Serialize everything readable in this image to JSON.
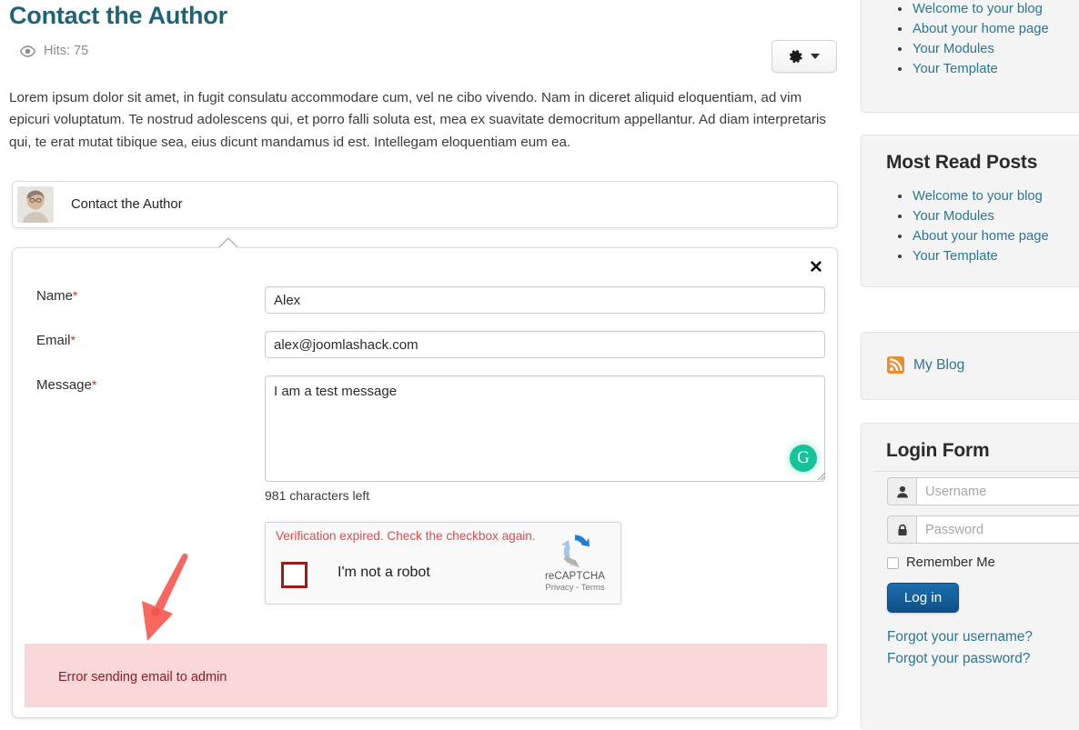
{
  "article": {
    "title": "Contact the Author",
    "hits_label": "Hits: 75",
    "body": "Lorem ipsum dolor sit amet, in fugit consulatu accommodare cum, vel ne cibo vivendo. Nam in diceret aliquid eloquentiam, ad vim epicuri voluptatum. Te nostrud adolescens qui, et porro falli soluta est, mea ex suavitate democritum appellantur. Ad diam interpretaris qui, te erat mutat tibique sea, eius dicunt mandamus id est. Intellegam eloquentiam eum ea.",
    "author_link_label": "Contact the Author"
  },
  "toolbar": {
    "gear_icon": "gear-icon",
    "caret_icon": "chevron-down-icon"
  },
  "contact_form": {
    "close_label": "✕",
    "fields": {
      "name": {
        "label": "Name",
        "required_marker": "*",
        "value": "Alex",
        "placeholder": ""
      },
      "email": {
        "label": "Email",
        "required_marker": "*",
        "value": "alex@joomlashack.com",
        "placeholder": ""
      },
      "message": {
        "label": "Message",
        "required_marker": "*",
        "value": "I am a test message",
        "placeholder": "",
        "characters_left": "981 characters left"
      }
    },
    "grammarly_badge": "G",
    "recaptcha": {
      "error_text": "Verification expired. Check the checkbox again.",
      "checkbox_label": "I'm not a robot",
      "brand_name": "reCAPTCHA",
      "terms_text": "Privacy - Terms",
      "checkbox_checked": false,
      "error_color": "#e04a4a",
      "checkbox_border_color": "#9c1a1a"
    },
    "alert": {
      "message": "Error sending email to admin",
      "background": "#f9d6d8",
      "text_color": "#8c1c28"
    }
  },
  "annotation": {
    "arrow_color": "#f7675f",
    "points_to": "Error sending email to admin"
  },
  "sidebar": {
    "top_module": {
      "items": [
        {
          "label": "Welcome to your blog"
        },
        {
          "label": "About your home page"
        },
        {
          "label": "Your Modules"
        },
        {
          "label": "Your Template"
        }
      ]
    },
    "most_read": {
      "title": "Most Read Posts",
      "items": [
        {
          "label": "Welcome to your blog"
        },
        {
          "label": "Your Modules"
        },
        {
          "label": "About your home page"
        },
        {
          "label": "Your Template"
        }
      ]
    },
    "syndicate": {
      "label": "My Blog",
      "icon": "rss-icon"
    },
    "login": {
      "title": "Login Form",
      "username_placeholder": "Username",
      "username_value": "",
      "password_placeholder": "Password",
      "password_value": "",
      "remember_label": "Remember Me",
      "remember_checked": false,
      "login_button": "Log in",
      "forgot_username": "Forgot your username?",
      "forgot_password": "Forgot your password?",
      "button_color": "#1461a0"
    }
  },
  "theme": {
    "link_color": "#2b7695",
    "title_color": "#1f6377",
    "page_background": "#ffffff"
  }
}
